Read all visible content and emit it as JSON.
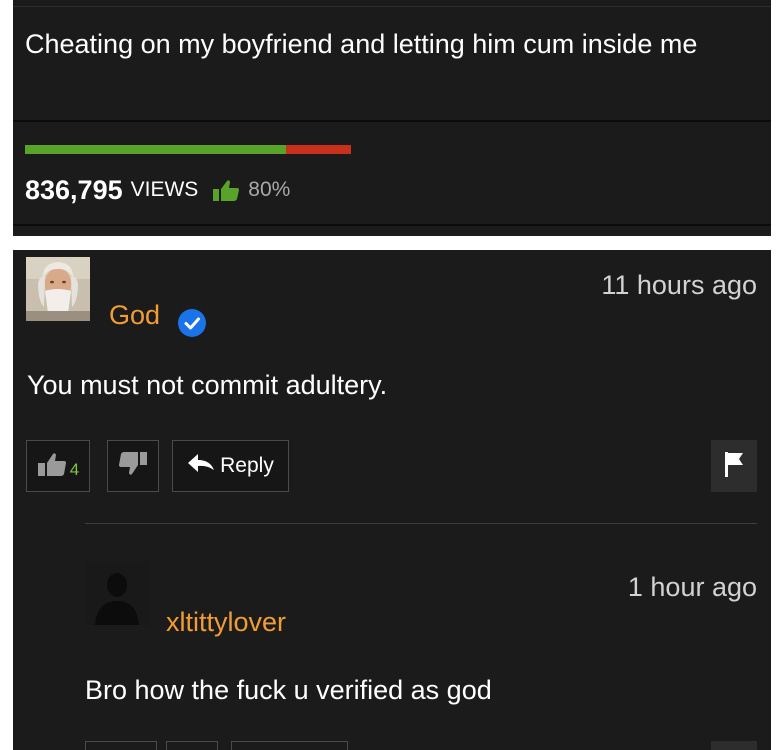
{
  "video": {
    "title": "Cheating on my boyfriend and letting him cum inside me",
    "views": "836,795",
    "views_label": "VIEWS",
    "rating": "80%",
    "rating_fraction": 0.8,
    "colors": {
      "like_green": "#5aa32b",
      "dislike_red": "#c9301c"
    }
  },
  "comment": {
    "avatar_icon": "god-portrait-avatar",
    "username": "God",
    "verified_icon": "verified-check-icon",
    "timestamp": "11 hours ago",
    "text": "You must not commit adultery.",
    "likes": "4",
    "reply_label": "Reply",
    "flag_icon": "flag-icon"
  },
  "reply": {
    "avatar_icon": "default-user-silhouette",
    "username": "xltittylover",
    "timestamp": "1 hour ago",
    "text": "Bro how the fuck u verified as god"
  },
  "accent_colors": {
    "username": "#f19c35",
    "verified": "#1a73e8"
  }
}
